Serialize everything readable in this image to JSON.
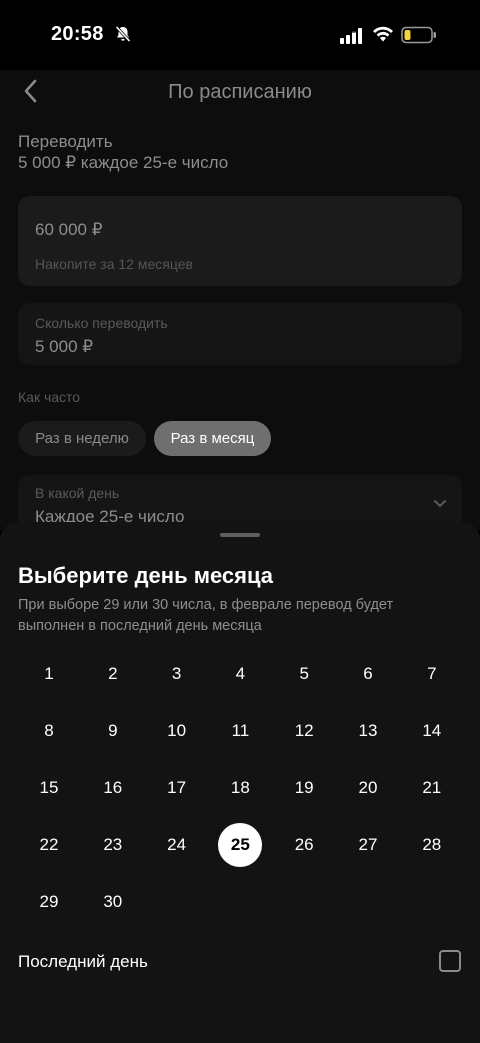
{
  "status_bar": {
    "time": "20:58",
    "icons": [
      "bell-slash-icon",
      "signal-icon",
      "wifi-icon",
      "battery-icon"
    ]
  },
  "header": {
    "title": "По расписанию",
    "back_icon": "chevron-left-icon"
  },
  "transfer": {
    "label": "Переводить",
    "summary": "5 000 ₽ каждое 25-е число"
  },
  "goal_card": {
    "amount": "60 000 ₽",
    "hint": "Накопите за 12 месяцев"
  },
  "amount_field": {
    "label": "Сколько переводить",
    "value": "5 000 ₽"
  },
  "frequency": {
    "label": "Как часто",
    "options": [
      "Раз в неделю",
      "Раз в месяц"
    ],
    "selected": "Раз в месяц"
  },
  "day_field": {
    "label": "В какой день",
    "value": "Каждое 25-е число",
    "icon": "chevron-down-icon"
  },
  "sheet": {
    "title": "Выберите день месяца",
    "description": "При выборе 29 или 30 числа, в феврале перевод будет выполнен в последний день месяца",
    "days": [
      "1",
      "2",
      "3",
      "4",
      "5",
      "6",
      "7",
      "8",
      "9",
      "10",
      "11",
      "12",
      "13",
      "14",
      "15",
      "16",
      "17",
      "18",
      "19",
      "20",
      "21",
      "22",
      "23",
      "24",
      "25",
      "26",
      "27",
      "28",
      "29",
      "30"
    ],
    "selected_day": "25",
    "last_day_label": "Последний день",
    "last_day_checked": false
  },
  "colors": {
    "background": "#000000",
    "sheet": "#131313",
    "selected_pill": "#6f6f6f",
    "selected_day": "#ffffff"
  }
}
